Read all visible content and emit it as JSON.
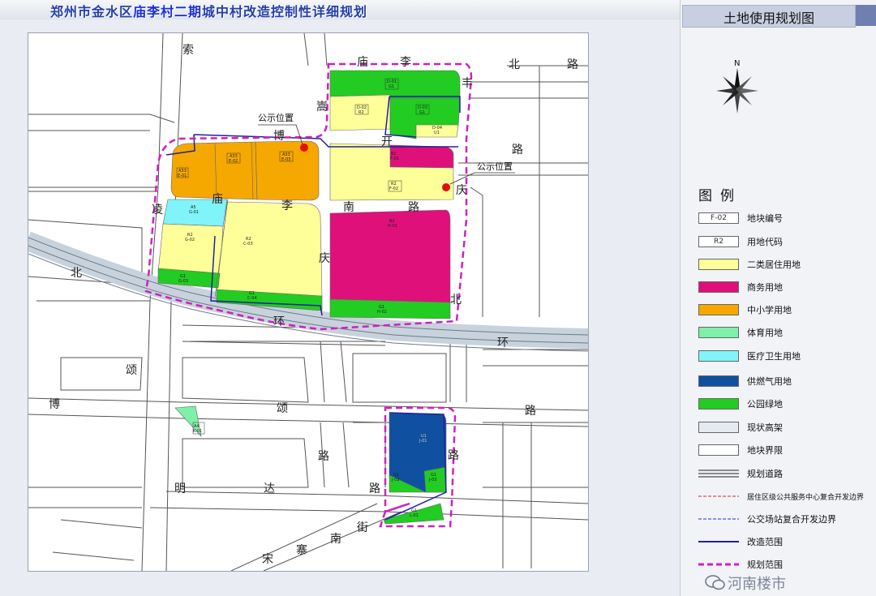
{
  "header": {
    "title_part1": "郑州市金水区",
    "title_part2": "庙李村二期",
    "title_part3": "城中村改造控制性详细规划"
  },
  "panel": {
    "title": "土地使用规划图",
    "compass_label": "N",
    "legend_heading": "图例",
    "legend": [
      {
        "swatch_text": "F-02",
        "label": "地块编号",
        "fill": "#ffffff",
        "kind": "box"
      },
      {
        "swatch_text": "R2",
        "label": "用地代码",
        "fill": "#ffffff",
        "kind": "box"
      },
      {
        "swatch_text": "",
        "label": "二类居住用地",
        "fill": "#ffff99",
        "kind": "box"
      },
      {
        "swatch_text": "",
        "label": "商务用地",
        "fill": "#e0107a",
        "kind": "box"
      },
      {
        "swatch_text": "",
        "label": "中小学用地",
        "fill": "#f5a800",
        "kind": "box"
      },
      {
        "swatch_text": "",
        "label": "体育用地",
        "fill": "#7ff0a8",
        "kind": "box"
      },
      {
        "swatch_text": "",
        "label": "医疗卫生用地",
        "fill": "#80f4f8",
        "kind": "box"
      },
      {
        "swatch_text": "",
        "label": "供燃气用地",
        "fill": "#1050a0",
        "kind": "box"
      },
      {
        "swatch_text": "",
        "label": "公园绿地",
        "fill": "#22cc22",
        "kind": "box"
      },
      {
        "swatch_text": "",
        "label": "现状高架",
        "fill": "#e4eaf0",
        "kind": "box"
      },
      {
        "swatch_text": "",
        "label": "地块界限",
        "fill": "#ffffff",
        "kind": "box"
      },
      {
        "swatch_text": "",
        "label": "规划道路",
        "fill": "#ffffff",
        "kind": "road"
      },
      {
        "swatch_text": "",
        "label": "居住区级公共服务中心复合开发边界",
        "fill": "#e02020",
        "kind": "dash-red"
      },
      {
        "swatch_text": "",
        "label": "公交场站复合开发边界",
        "fill": "#2030c0",
        "kind": "dash-blue"
      },
      {
        "swatch_text": "",
        "label": "改造范围",
        "fill": "#2020a0",
        "kind": "solid-blue"
      },
      {
        "swatch_text": "",
        "label": "规划范围",
        "fill": "#d020c0",
        "kind": "dash-magenta"
      }
    ]
  },
  "map": {
    "notice_labels": [
      "公示位置",
      "公示位置"
    ],
    "road_chars": [
      "索",
      "庙",
      "李",
      "丰",
      "北",
      "路",
      "博",
      "凌",
      "庙",
      "李",
      "南",
      "路",
      "庆",
      "庆",
      "北",
      "北",
      "环",
      "博",
      "颂",
      "路",
      "路",
      "路",
      "明",
      "达",
      "路",
      "南",
      "街",
      "宋",
      "寨",
      "路",
      "开",
      "嵩"
    ],
    "parcels": [
      {
        "code": "A33",
        "id": "E-02",
        "color": "#f5a800"
      },
      {
        "code": "A33",
        "id": "E-03",
        "color": "#f5a800"
      },
      {
        "code": "A33",
        "id": "E-01",
        "color": "#f5a800"
      },
      {
        "code": "A5",
        "id": "G-01",
        "color": "#80f4f8"
      },
      {
        "code": "R2",
        "id": "G-02",
        "color": "#ffff99"
      },
      {
        "code": "R2",
        "id": "C-03",
        "color": "#ffff99"
      },
      {
        "code": "G1",
        "id": "G-03",
        "color": "#22cc22"
      },
      {
        "code": "G1",
        "id": "C-04",
        "color": "#22cc22"
      },
      {
        "code": "G1",
        "id": "D-01",
        "color": "#22cc22"
      },
      {
        "code": "R2",
        "id": "D-02",
        "color": "#ffff99"
      },
      {
        "code": "G1",
        "id": "D-03",
        "color": "#22cc22"
      },
      {
        "code": "U1",
        "id": "D-04",
        "color": "#ffff99"
      },
      {
        "code": "B2",
        "id": "F-01",
        "color": "#e0107a"
      },
      {
        "code": "R2",
        "id": "F-02",
        "color": "#ffff99"
      },
      {
        "code": "B2",
        "id": "H-01",
        "color": "#e0107a"
      },
      {
        "code": "G1",
        "id": "H-02",
        "color": "#22cc22"
      },
      {
        "code": "A4",
        "id": "K-01",
        "color": "#7ff0a8"
      },
      {
        "code": "U1",
        "id": "J-01",
        "color": "#1050a0"
      },
      {
        "code": "G1",
        "id": "J-02",
        "color": "#22cc22"
      },
      {
        "code": "G1",
        "id": "J-03",
        "color": "#22cc22"
      },
      {
        "code": "G1",
        "id": "L-01",
        "color": "#22cc22"
      }
    ]
  },
  "watermark": "河南楼市"
}
